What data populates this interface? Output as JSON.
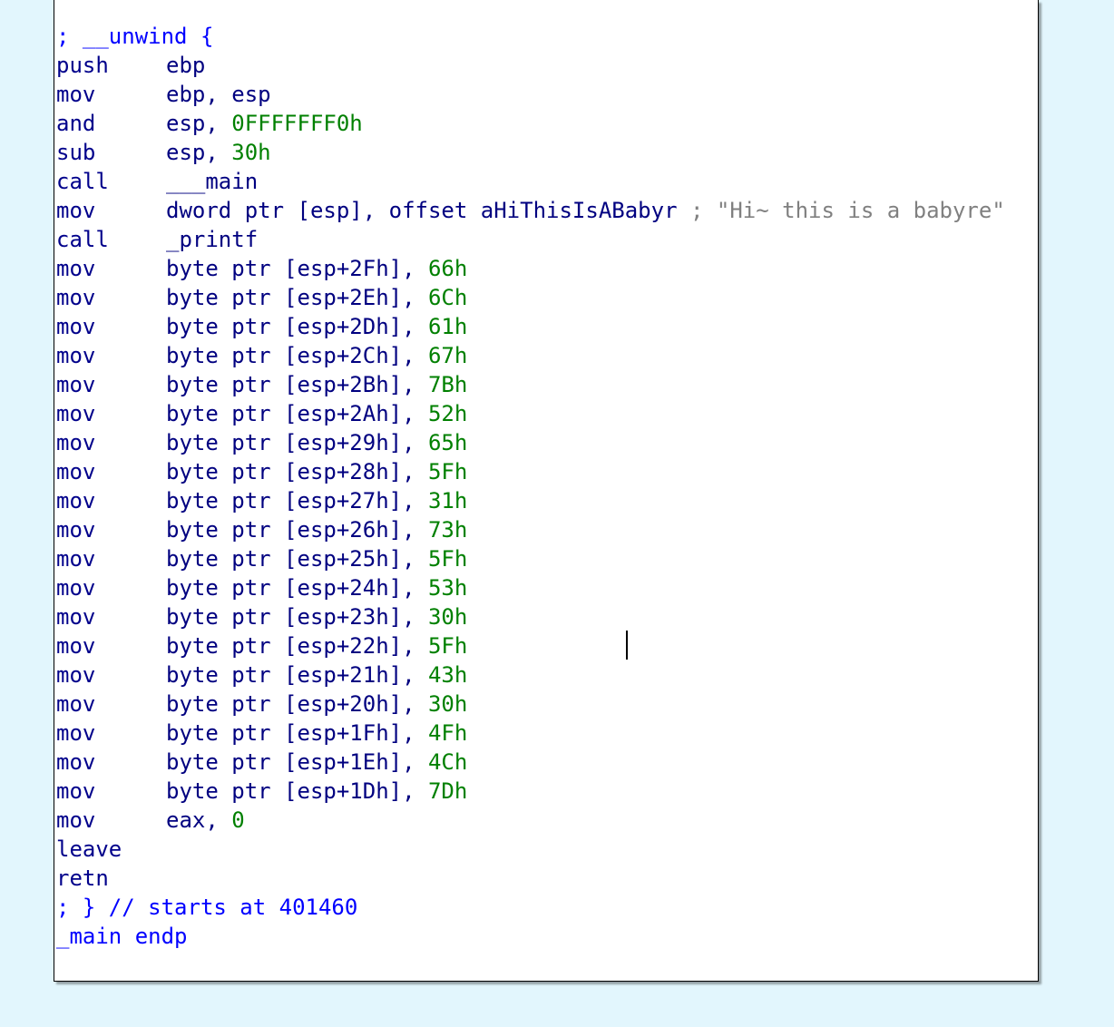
{
  "colors": {
    "background": "#e2f6fd",
    "panel": "#ffffff",
    "mnemonic": "#00008b",
    "immediate": "#008000",
    "directive": "#0000ff",
    "comment": "#808080"
  },
  "listing": {
    "header": "; __unwind {",
    "instructions": [
      {
        "mnemonic": "push",
        "ops": [
          "ebp"
        ]
      },
      {
        "mnemonic": "mov",
        "ops": [
          "ebp, esp"
        ]
      },
      {
        "mnemonic": "and",
        "ops": [
          "esp, ",
          "0FFFFFFF0h"
        ]
      },
      {
        "mnemonic": "sub",
        "ops": [
          "esp, ",
          "30h"
        ]
      },
      {
        "mnemonic": "call",
        "ops": [
          "___main"
        ]
      },
      {
        "mnemonic": "mov",
        "ops": [
          "dword ptr [esp], offset aHiThisIsABabyr",
          " ; \"Hi~ this is a babyre\""
        ]
      },
      {
        "mnemonic": "call",
        "ops": [
          "_printf"
        ]
      },
      {
        "mnemonic": "mov",
        "ops": [
          "byte ptr [esp+2Fh], ",
          "66h"
        ]
      },
      {
        "mnemonic": "mov",
        "ops": [
          "byte ptr [esp+2Eh], ",
          "6Ch"
        ]
      },
      {
        "mnemonic": "mov",
        "ops": [
          "byte ptr [esp+2Dh], ",
          "61h"
        ]
      },
      {
        "mnemonic": "mov",
        "ops": [
          "byte ptr [esp+2Ch], ",
          "67h"
        ]
      },
      {
        "mnemonic": "mov",
        "ops": [
          "byte ptr [esp+2Bh], ",
          "7Bh"
        ]
      },
      {
        "mnemonic": "mov",
        "ops": [
          "byte ptr [esp+2Ah], ",
          "52h"
        ]
      },
      {
        "mnemonic": "mov",
        "ops": [
          "byte ptr [esp+29h], ",
          "65h"
        ]
      },
      {
        "mnemonic": "mov",
        "ops": [
          "byte ptr [esp+28h], ",
          "5Fh"
        ]
      },
      {
        "mnemonic": "mov",
        "ops": [
          "byte ptr [esp+27h], ",
          "31h"
        ]
      },
      {
        "mnemonic": "mov",
        "ops": [
          "byte ptr [esp+26h], ",
          "73h"
        ]
      },
      {
        "mnemonic": "mov",
        "ops": [
          "byte ptr [esp+25h], ",
          "5Fh"
        ]
      },
      {
        "mnemonic": "mov",
        "ops": [
          "byte ptr [esp+24h], ",
          "53h"
        ]
      },
      {
        "mnemonic": "mov",
        "ops": [
          "byte ptr [esp+23h], ",
          "30h"
        ]
      },
      {
        "mnemonic": "mov",
        "ops": [
          "byte ptr [esp+22h], ",
          "5Fh"
        ]
      },
      {
        "mnemonic": "mov",
        "ops": [
          "byte ptr [esp+21h], ",
          "43h"
        ]
      },
      {
        "mnemonic": "mov",
        "ops": [
          "byte ptr [esp+20h], ",
          "30h"
        ]
      },
      {
        "mnemonic": "mov",
        "ops": [
          "byte ptr [esp+1Fh], ",
          "4Fh"
        ]
      },
      {
        "mnemonic": "mov",
        "ops": [
          "byte ptr [esp+1Eh], ",
          "4Ch"
        ]
      },
      {
        "mnemonic": "mov",
        "ops": [
          "byte ptr [esp+1Dh], ",
          "7Dh"
        ]
      },
      {
        "mnemonic": "mov",
        "ops": [
          "eax, ",
          "0"
        ]
      },
      {
        "mnemonic": "leave",
        "ops": []
      },
      {
        "mnemonic": "retn",
        "ops": []
      }
    ],
    "footer_comment": "; } // starts at 401460",
    "endp": "_main endp"
  }
}
